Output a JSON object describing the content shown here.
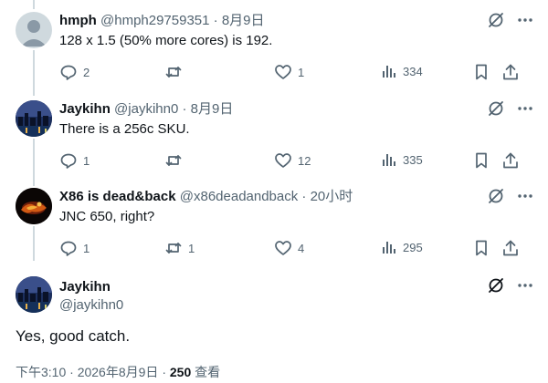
{
  "replies": [
    {
      "name": "hmph",
      "handle": "@hmph29759351",
      "sep": "·",
      "time": "8月9日",
      "text": "128 x 1.5 (50% more cores) is 192.",
      "reply_count": "2",
      "retweet_count": "",
      "like_count": "1",
      "view_count": "334",
      "avatar": "default-avatar"
    },
    {
      "name": "Jaykihn",
      "handle": "@jaykihn0",
      "sep": "·",
      "time": "8月9日",
      "text": "There is a 256c SKU.",
      "reply_count": "1",
      "retweet_count": "",
      "like_count": "12",
      "view_count": "335",
      "avatar": "city-night-avatar"
    },
    {
      "name": "X86 is dead&back",
      "handle": "@x86deadandback",
      "sep": "·",
      "time": "20小时",
      "text": "JNC 650, right?",
      "reply_count": "1",
      "retweet_count": "1",
      "like_count": "4",
      "view_count": "295",
      "avatar": "fire-figure-avatar"
    }
  ],
  "main_post": {
    "name": "Jaykihn",
    "handle": "@jaykihn0",
    "text": "Yes, good catch.",
    "time": "下午3:10",
    "sep1": "·",
    "date": "2026年8月9日",
    "sep2": "·",
    "views": "250",
    "views_label": "查看"
  },
  "icons": {
    "grok": "grok-icon",
    "more": "more-icon",
    "reply": "reply-icon",
    "retweet": "retweet-icon",
    "like": "like-icon",
    "views": "views-icon",
    "bookmark": "bookmark-icon",
    "share": "share-icon"
  },
  "colors": {
    "text": "#0f1419",
    "secondary": "#536471",
    "thread_line": "#cfd9de",
    "divider": "#eff3f4"
  }
}
